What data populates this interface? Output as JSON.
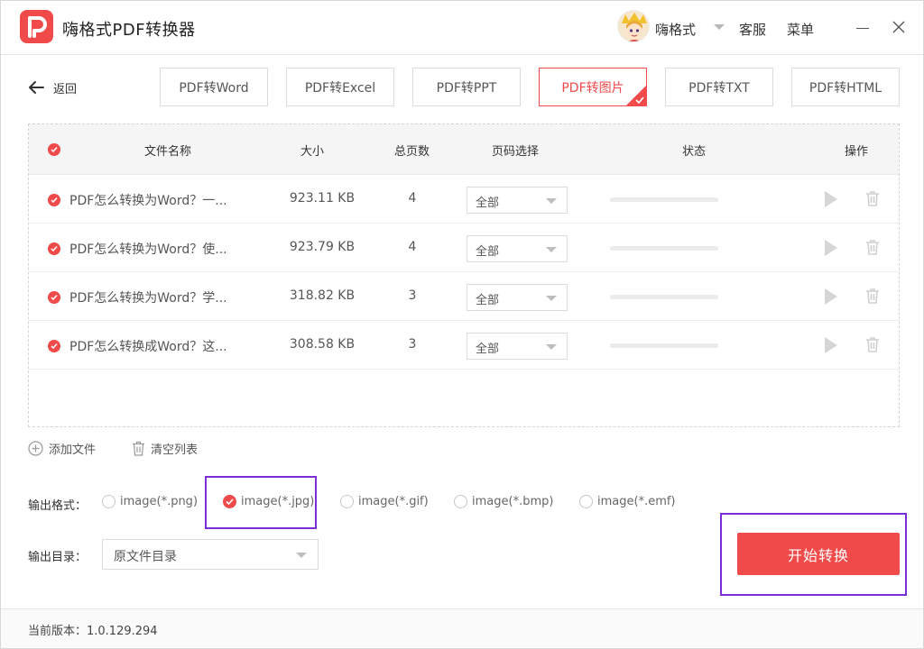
{
  "app": {
    "title": "嗨格式PDF转换器"
  },
  "user": {
    "name": "嗨格式"
  },
  "header": {
    "service": "客服",
    "menu": "菜单"
  },
  "nav": {
    "back_label": "返回"
  },
  "tabs": [
    {
      "label": "PDF转Word",
      "active": false
    },
    {
      "label": "PDF转Excel",
      "active": false
    },
    {
      "label": "PDF转PPT",
      "active": false
    },
    {
      "label": "PDF转图片",
      "active": true
    },
    {
      "label": "PDF转TXT",
      "active": false
    },
    {
      "label": "PDF转HTML",
      "active": false
    }
  ],
  "table": {
    "headers": {
      "name": "文件名称",
      "size": "大小",
      "pages": "总页数",
      "page_select": "页码选择",
      "status": "状态",
      "actions": "操作"
    },
    "rows": [
      {
        "name": "PDF怎么转换为Word？一...",
        "size": "923.11 KB",
        "pages": "4",
        "page_select": "全部",
        "progress": 0
      },
      {
        "name": "PDF怎么转换为Word？使...",
        "size": "923.79 KB",
        "pages": "4",
        "page_select": "全部",
        "progress": 0
      },
      {
        "name": "PDF怎么转换为Word？学...",
        "size": "318.82 KB",
        "pages": "3",
        "page_select": "全部",
        "progress": 0
      },
      {
        "name": "PDF怎么转换成Word？这...",
        "size": "308.58 KB",
        "pages": "3",
        "page_select": "全部",
        "progress": 0
      }
    ]
  },
  "actions": {
    "add_file": "添加文件",
    "clear_list": "清空列表"
  },
  "output": {
    "format_label": "输出格式：",
    "formats": [
      {
        "label": "image(*.png)",
        "checked": false
      },
      {
        "label": "image(*.jpg)",
        "checked": true
      },
      {
        "label": "image(*.gif)",
        "checked": false
      },
      {
        "label": "image(*.bmp)",
        "checked": false
      },
      {
        "label": "image(*.emf)",
        "checked": false
      }
    ],
    "dir_label": "输出目录：",
    "dir_value": "原文件目录"
  },
  "start_button": "开始转换",
  "footer": {
    "version": "当前版本：1.0.129.294"
  },
  "colors": {
    "accent": "#f04a4a",
    "highlight": "#7a2ed6"
  }
}
